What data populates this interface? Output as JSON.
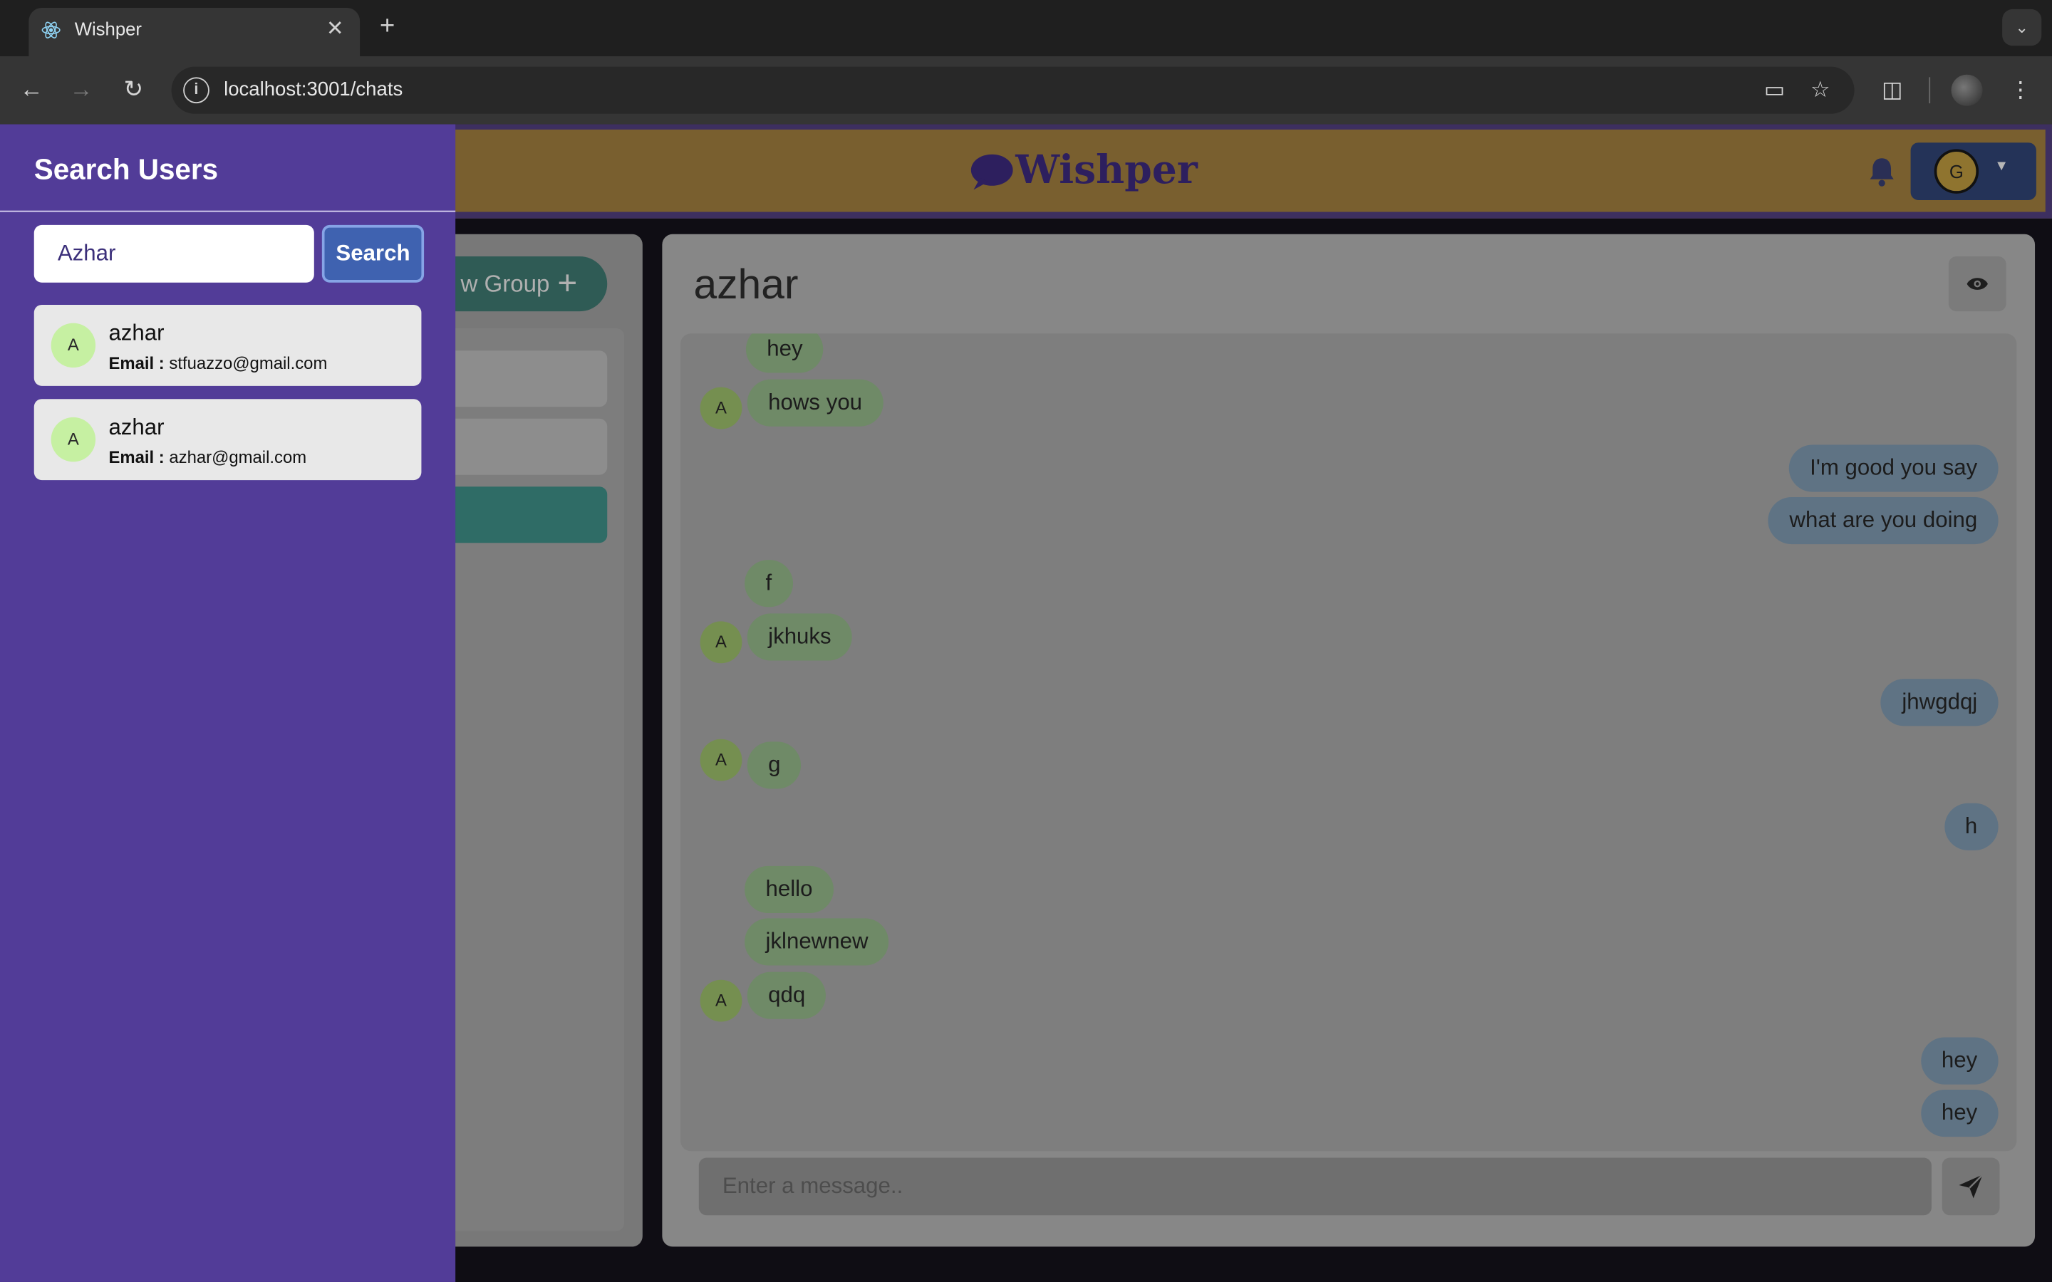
{
  "browser": {
    "tab_title": "Wishper",
    "tab_close": "✕",
    "new_tab": "+",
    "url": "localhost:3001/chats"
  },
  "app": {
    "brand": "Wishper",
    "user_initial": "G",
    "new_group_label": "w Group",
    "new_group_plus": "+"
  },
  "chat": {
    "title": "azhar",
    "composer_placeholder": "Enter a message..",
    "messages": [
      {
        "from": "in",
        "text": "hey",
        "avatar": ""
      },
      {
        "from": "in",
        "text": "hows you",
        "avatar": "A"
      },
      {
        "from": "out",
        "text": "I'm good you say"
      },
      {
        "from": "out",
        "text": "what are you doing"
      },
      {
        "from": "in",
        "text": "f",
        "avatar": ""
      },
      {
        "from": "in",
        "text": "jkhuks",
        "avatar": "A"
      },
      {
        "from": "out",
        "text": "jhwgdqj"
      },
      {
        "from": "in",
        "text": "g",
        "avatar": "A"
      },
      {
        "from": "out",
        "text": "h"
      },
      {
        "from": "in",
        "text": "hello",
        "avatar": ""
      },
      {
        "from": "in",
        "text": "jklnewnew",
        "avatar": ""
      },
      {
        "from": "in",
        "text": "qdq",
        "avatar": "A"
      },
      {
        "from": "out",
        "text": "hey"
      },
      {
        "from": "out",
        "text": "hey"
      }
    ]
  },
  "drawer": {
    "title": "Search Users",
    "search_value": "Azhar",
    "search_button": "Search",
    "results": [
      {
        "initial": "A",
        "name": "azhar",
        "email_label": "Email :",
        "email": "stfuazzo@gmail.com"
      },
      {
        "initial": "A",
        "name": "azhar",
        "email_label": "Email :",
        "email": "azhar@gmail.com"
      }
    ]
  },
  "colors": {
    "drawer_bg": "#523c98",
    "header_bg": "#795f2f",
    "active_chat": "#2f6c66",
    "search_button": "#3f62b0"
  }
}
